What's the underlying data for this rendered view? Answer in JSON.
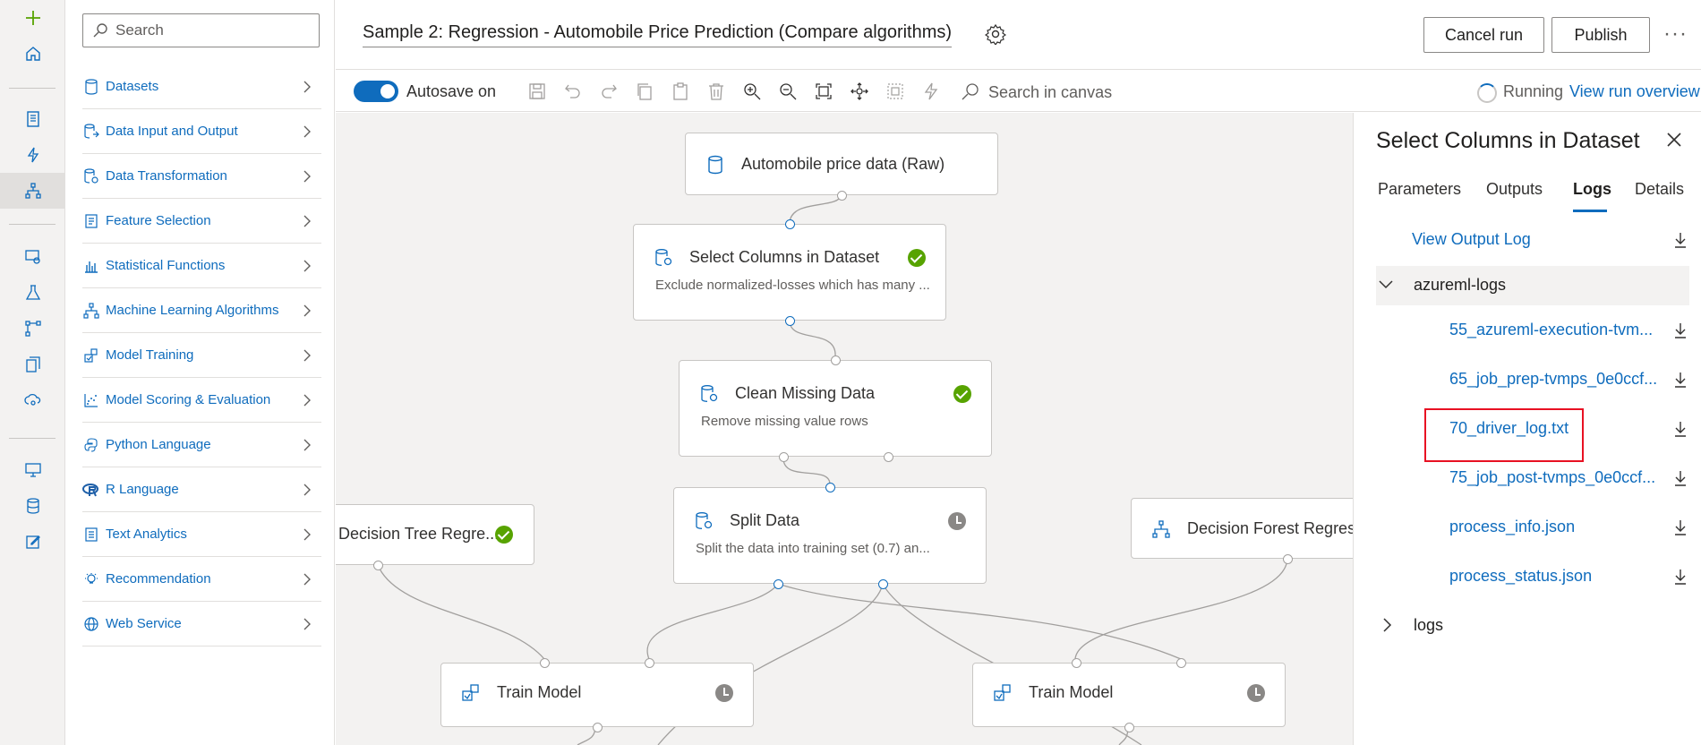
{
  "rail": {
    "items": [
      "add-icon",
      "home-icon",
      "notebook-icon",
      "automl-icon",
      "designer-icon",
      "data-labeling-icon",
      "experiments-icon",
      "pipelines-icon",
      "models-icon",
      "endpoints-icon",
      "compute-icon",
      "datastores-icon",
      "edit-icon"
    ]
  },
  "palette": {
    "search_placeholder": "Search",
    "categories": [
      {
        "label": "Datasets",
        "icon": "dataset-icon"
      },
      {
        "label": "Data Input and Output",
        "icon": "data-io-icon"
      },
      {
        "label": "Data Transformation",
        "icon": "data-transform-icon"
      },
      {
        "label": "Feature Selection",
        "icon": "feature-selection-icon"
      },
      {
        "label": "Statistical Functions",
        "icon": "statistics-icon"
      },
      {
        "label": "Machine Learning Algorithms",
        "icon": "ml-algorithm-icon"
      },
      {
        "label": "Model Training",
        "icon": "model-training-icon"
      },
      {
        "label": "Model Scoring & Evaluation",
        "icon": "scoring-icon"
      },
      {
        "label": "Python Language",
        "icon": "python-icon"
      },
      {
        "label": "R Language",
        "icon": "r-icon"
      },
      {
        "label": "Text Analytics",
        "icon": "text-analytics-icon"
      },
      {
        "label": "Recommendation",
        "icon": "recommendation-icon"
      },
      {
        "label": "Web Service",
        "icon": "web-service-icon"
      }
    ]
  },
  "header": {
    "title": "Sample 2: Regression - Automobile Price Prediction (Compare algorithms)",
    "cancel_label": "Cancel run",
    "publish_label": "Publish",
    "more_label": "···"
  },
  "toolbar": {
    "autosave_label": "Autosave on",
    "search_label": "Search in canvas",
    "status_label": "Running",
    "run_overview_label": "View run overview"
  },
  "canvas": {
    "nodes": [
      {
        "title": "Automobile price data (Raw)",
        "subtitle": "",
        "status": ""
      },
      {
        "title": "Select Columns in Dataset",
        "subtitle": "Exclude normalized-losses which has many ...",
        "status": "completed"
      },
      {
        "title": "Clean Missing Data",
        "subtitle": "Remove missing value rows",
        "status": "completed"
      },
      {
        "title": "Split Data",
        "subtitle": "Split the data into training set (0.7) an...",
        "status": "queued"
      },
      {
        "title": "Decision Tree Regre...",
        "subtitle": "",
        "status": "completed"
      },
      {
        "title": "Decision Forest Regress",
        "subtitle": "",
        "status": ""
      },
      {
        "title": "Train Model",
        "subtitle": "",
        "status": "queued"
      },
      {
        "title": "Train Model",
        "subtitle": "",
        "status": "queued"
      }
    ]
  },
  "panel": {
    "title": "Select Columns in Dataset",
    "tabs": [
      "Parameters",
      "Outputs",
      "Logs",
      "Details"
    ],
    "active_tab": "Logs",
    "output_log": "View Output Log",
    "group1": "azureml-logs",
    "files": [
      "55_azureml-execution-tvm...",
      "65_job_prep-tvmps_0e0ccf...",
      "70_driver_log.txt",
      "75_job_post-tvmps_0e0ccf...",
      "process_info.json",
      "process_status.json"
    ],
    "group2": "logs"
  },
  "colors": {
    "accent": "#0f6cbd",
    "success": "#57a300",
    "highlight": "#e81123"
  }
}
